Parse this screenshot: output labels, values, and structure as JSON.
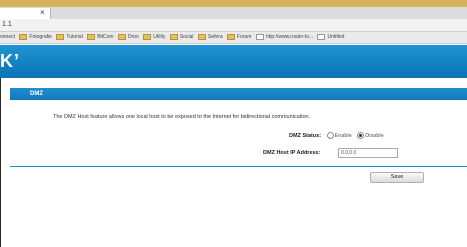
{
  "browser": {
    "tab_label": "",
    "tab_close": "×",
    "address_text": "1.1",
    "bookmarks": [
      {
        "label": "onnect"
      },
      {
        "label": "Fotografie"
      },
      {
        "label": "Tutorial"
      },
      {
        "label": "BitCom"
      },
      {
        "label": "Droo"
      },
      {
        "label": "Utility"
      },
      {
        "label": "Social"
      },
      {
        "label": "Sefera"
      },
      {
        "label": "Forum"
      },
      {
        "label": "http://www.router-lo..."
      },
      {
        "label": "Untitled"
      }
    ]
  },
  "header": {
    "logo": "K’"
  },
  "dmz": {
    "section_title": "DMZ",
    "description": "The DMZ Host feature allows one local host to be exposed to the Internet for bidirectional communication.",
    "status_label": "DMZ Status:",
    "option_enable": "Enable",
    "option_disable": "Disable",
    "ip_label": "DMZ Host IP Address:",
    "ip_value": "0.0.0.0",
    "save_label": "Save"
  },
  "colors": {
    "accent": "#1377bb",
    "top_strip": "#d9b35c"
  }
}
